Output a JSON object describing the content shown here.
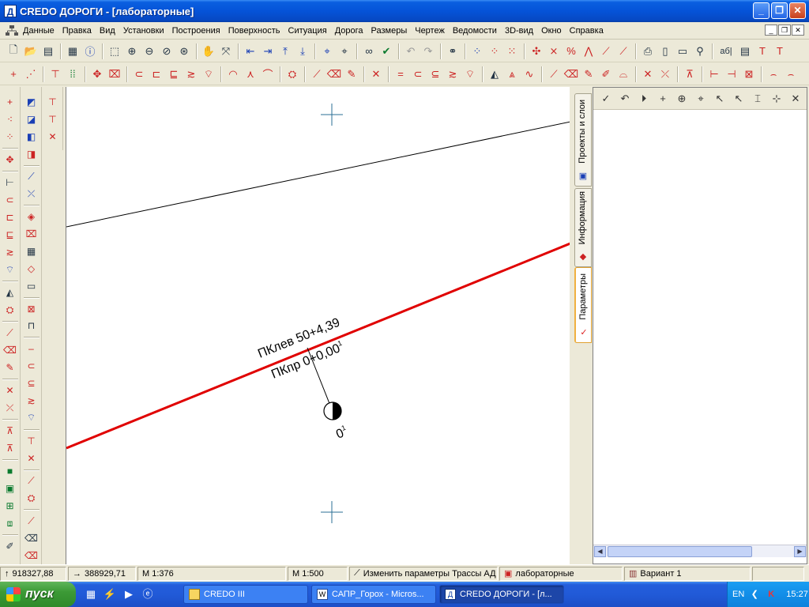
{
  "window": {
    "title": "CREDO ДОРОГИ - [лабораторные]",
    "app_icon": "Д"
  },
  "menu": {
    "items": [
      "Данные",
      "Правка",
      "Вид",
      "Установки",
      "Построения",
      "Поверхность",
      "Ситуация",
      "Дорога",
      "Размеры",
      "Чертеж",
      "Ведомости",
      "3D-вид",
      "Окно",
      "Справка"
    ]
  },
  "toolbar1": {
    "text_tool": "аб|"
  },
  "canvas": {
    "label_left": "ПКлев 50+4,39",
    "label_right": "ПКпр 0+0,00",
    "label_right_sup": "1",
    "point_label": "0",
    "point_label_sup": "1",
    "colors": {
      "axis_line": "#e00000",
      "line": "#000000",
      "cross": "#2b6f96"
    }
  },
  "right_panel": {
    "tabs": [
      {
        "label": "Проекты и слои",
        "icon": "layers-icon"
      },
      {
        "label": "Информация",
        "icon": "info-icon"
      },
      {
        "label": "Параметры",
        "icon": "check-icon"
      }
    ]
  },
  "status": {
    "coord_north": "918327,88",
    "coord_east": "388929,71",
    "scale1": "М 1:376",
    "scale2": "М 1:500",
    "command": "Изменить параметры Трассы АД",
    "layer": "лабораторные",
    "variant": "Вариант 1"
  },
  "taskbar": {
    "start": "пуск",
    "tasks": [
      {
        "label": "CREDO III",
        "active": false
      },
      {
        "label": "САПР_Горох - Micros...",
        "active": false
      },
      {
        "label": "CREDO ДОРОГИ - [л...",
        "active": true
      }
    ],
    "lang": "EN",
    "clock": "15:27"
  }
}
